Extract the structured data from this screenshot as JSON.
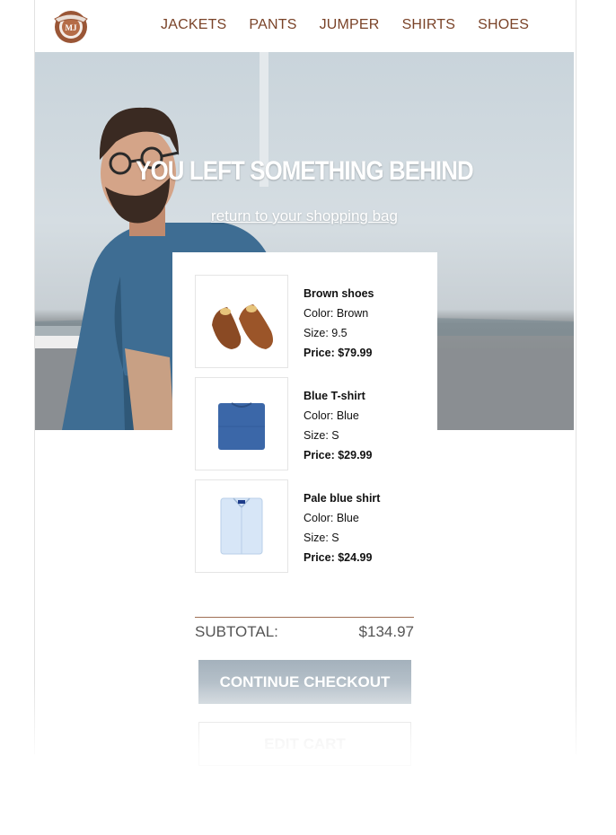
{
  "header": {
    "logo_icon": "brand-emblem-icon",
    "nav": [
      "JACKETS",
      "PANTS",
      "JUMPER",
      "SHIRTS",
      "SHOES"
    ]
  },
  "hero": {
    "title": "YOU LEFT SOMETHING BEHIND",
    "link": "return to your shopping bag"
  },
  "cart": {
    "items": [
      {
        "name": "Brown shoes",
        "color": "Color: Brown",
        "size": "Size: 9.5",
        "price": "Price: $79.99",
        "icon": "brown-shoes-icon"
      },
      {
        "name": "Blue T-shirt",
        "color": "Color: Blue",
        "size": "Size: S",
        "price": "Price: $29.99",
        "icon": "blue-tshirt-icon"
      },
      {
        "name": "Pale blue shirt",
        "color": "Color: Blue",
        "size": "Size: S",
        "price": "Price: $24.99",
        "icon": "pale-blue-shirt-icon"
      }
    ],
    "subtotal_label": "SUBTOTAL:",
    "subtotal_value": "$134.97",
    "checkout_label": "CONTINUE CHECKOUT",
    "edit_label": "EDIT CART"
  },
  "colors": {
    "accent_brown": "#7a4328",
    "button_gray": "#b3bfc8"
  }
}
